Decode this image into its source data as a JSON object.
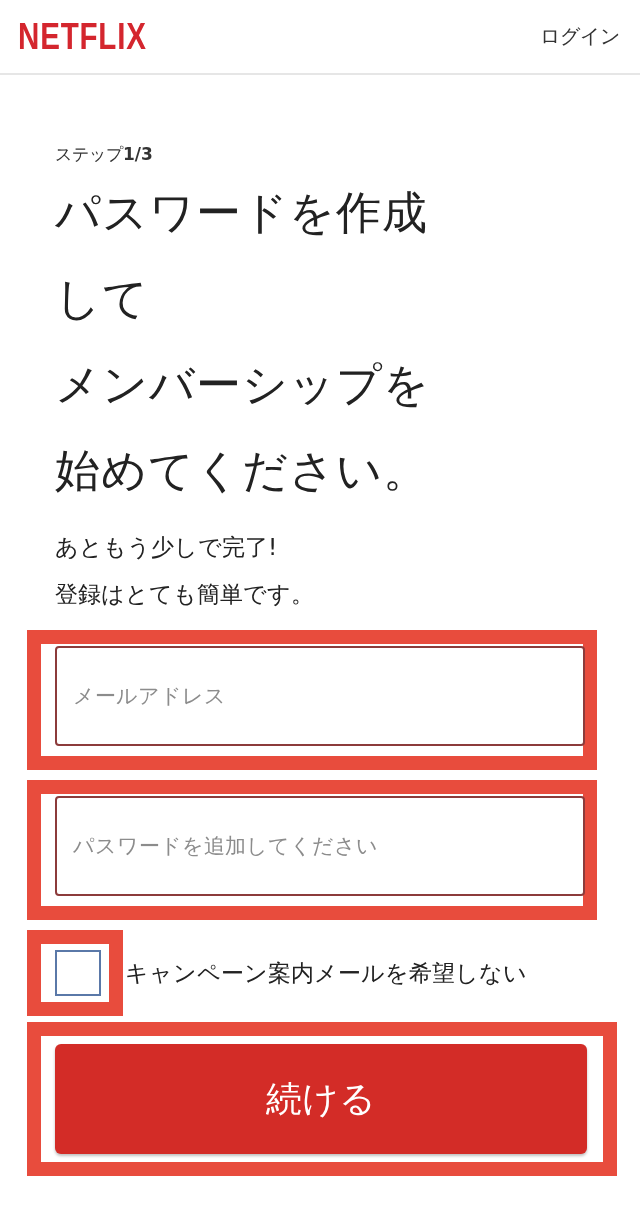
{
  "header": {
    "logo": "NETFLIX",
    "login_link": "ログイン"
  },
  "step_label": "ステップ**1/3**",
  "heading": {
    "lines": [
      "パスワードを作成",
      "して",
      "メンバーシップを",
      "始めてください。"
    ]
  },
  "intro": {
    "lines": [
      "あともう少しで完了!",
      "登録はとても簡単です。"
    ]
  },
  "fields": [
    {
      "placeholder": "メールアドレス"
    },
    {
      "placeholder": "パスワードを追加してください"
    }
  ],
  "opt_out": {
    "label": "キャンペーン案内メールを希望しない",
    "checked": false
  },
  "continue_button": "続ける"
}
